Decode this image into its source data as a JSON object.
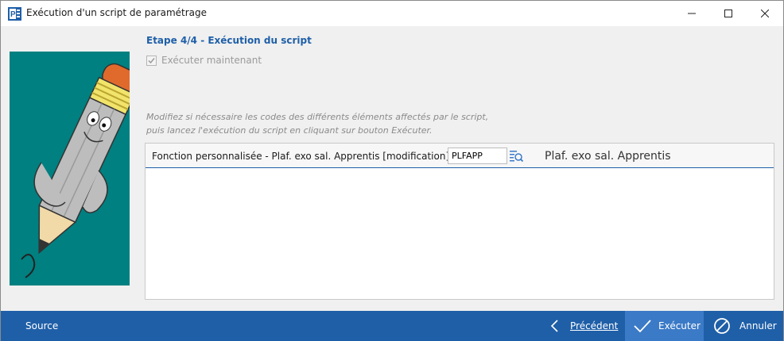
{
  "window": {
    "title": "Exécution d'un script de paramétrage"
  },
  "step": {
    "title": "Etape 4/4 - Exécution du script",
    "run_now_label": "Exécuter maintenant",
    "run_now_checked": true
  },
  "instructions": {
    "line1": "Modifiez si nécessaire les codes des différents éléments affectés par le script,",
    "line2": "puis lancez l'exécution du script en cliquant sur bouton Exécuter."
  },
  "elements": [
    {
      "label": "Fonction personnalisée - Plaf. exo sal. Apprentis [modification]",
      "code": "PLFAPP",
      "description": "Plaf. exo sal. Apprentis"
    }
  ],
  "footer": {
    "source_label": "Source",
    "previous_label": "Précédent",
    "execute_label": "Exécuter",
    "cancel_label": "Annuler"
  },
  "colors": {
    "accent": "#1f5fa8",
    "execute_button": "#3b7ac7",
    "side_image_background": "#008080"
  }
}
